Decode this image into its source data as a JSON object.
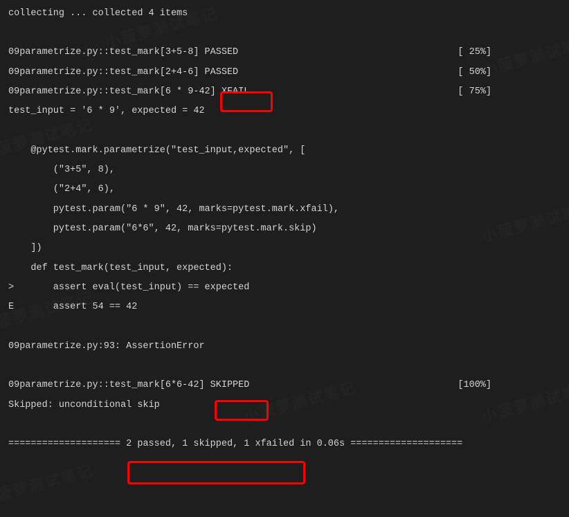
{
  "collecting": "collecting ... collected 4 items",
  "results": [
    {
      "name": "09parametrize.py::test_mark[3+5-8] PASSED",
      "pct": "[ 25%]"
    },
    {
      "name": "09parametrize.py::test_mark[2+4-6] PASSED",
      "pct": "[ 50%]"
    },
    {
      "name_pre": "09parametrize.py::test_mark[6 * 9-42] ",
      "status": "XFAIL",
      "pct": "[ 75%]"
    }
  ],
  "detail_header": "test_input = '6 * 9', expected = 42",
  "code": [
    "    @pytest.mark.parametrize(\"test_input,expected\", [",
    "        (\"3+5\", 8),",
    "        (\"2+4\", 6),",
    "        pytest.param(\"6 * 9\", 42, marks=pytest.mark.xfail),",
    "        pytest.param(\"6*6\", 42, marks=pytest.mark.skip)",
    "    ])",
    "    def test_mark(test_input, expected):",
    ">       assert eval(test_input) == expected",
    "E       assert 54 == 42"
  ],
  "assertion": "09parametrize.py:93: AssertionError",
  "skipped": {
    "name_pre": "09parametrize.py::test_mark[6*6-42] ",
    "status": "SKIPPED",
    "pct": "[100%]"
  },
  "skip_reason": "Skipped: unconditional skip",
  "summary_pre": "==================== ",
  "summary_body": "2 passed, 1 skipped, 1 xfailed i",
  "summary_post": "n 0.06s ====================",
  "watermark_text": "小菠萝测试笔记"
}
